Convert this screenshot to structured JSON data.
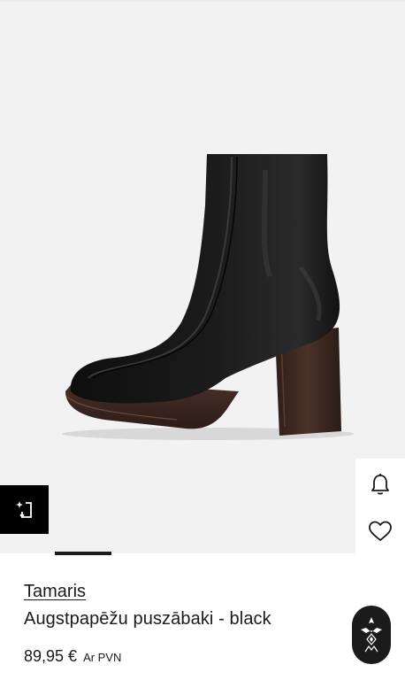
{
  "product": {
    "brand": "Tamaris",
    "name": "Augstpapēžu puszābaki - black",
    "price": "89,95 €",
    "vat_note": "Ar PVN",
    "image": "black-ankle-boot-icon"
  },
  "gallery": {
    "current_image_fraction": 0.17
  },
  "actions": {
    "notify_icon": "bell-icon",
    "wishlist_icon": "heart-icon",
    "compare_icon": "sparkle-arrow-icon",
    "brand_logo_icon": "brand-logo-icon"
  },
  "colors": {
    "gallery_background": "#f2f2f2",
    "text": "#1a1a1a",
    "accent": "#000000"
  }
}
